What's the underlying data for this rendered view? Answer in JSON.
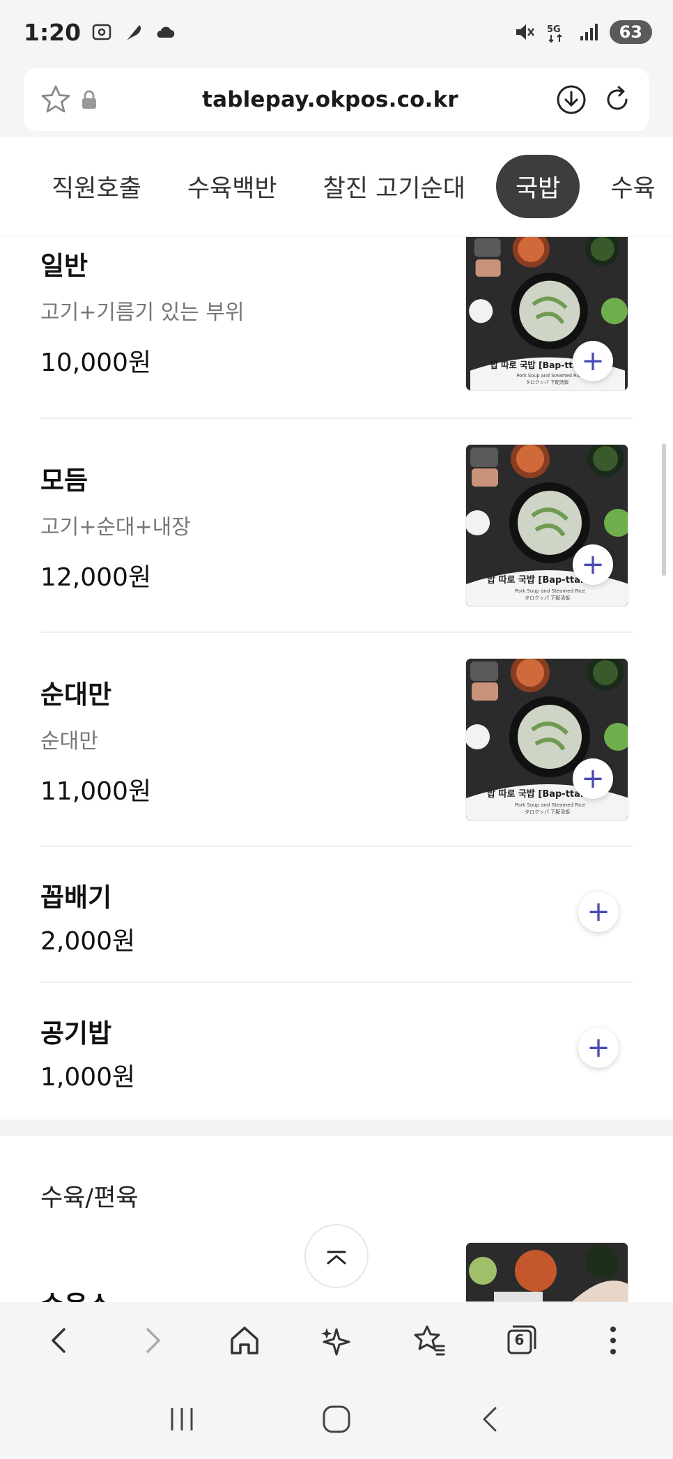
{
  "status": {
    "time": "1:20",
    "battery": "63"
  },
  "browser": {
    "url": "tablepay.okpos.co.kr",
    "tab_count": "6"
  },
  "categories": [
    "직원호출",
    "수육백반",
    "찰진 고기순대",
    "국밥",
    "수육"
  ],
  "active_category": "국밥",
  "menu": {
    "items": [
      {
        "name": "일반",
        "desc": "고기+기름기 있는 부위",
        "price": "10,000원"
      },
      {
        "name": "모듬",
        "desc": "고기+순대+내장",
        "price": "12,000원"
      },
      {
        "name": "순대만",
        "desc": "순대만",
        "price": "11,000원"
      },
      {
        "name": "꼽배기",
        "price": "2,000원"
      },
      {
        "name": "공기밥",
        "price": "1,000원"
      }
    ],
    "image_caption": "밥 따로 국밥 [Bap-ttaro",
    "image_caption_sub": "Pork Soup and Steamed Rice",
    "image_caption_sub2": "タロクッパ 下配汤饭",
    "next_section": "수육/편육",
    "next_item_partial": "수육소"
  },
  "colors": {
    "accent": "#4a4ab8",
    "active_tab_bg": "#3d3d3d"
  }
}
